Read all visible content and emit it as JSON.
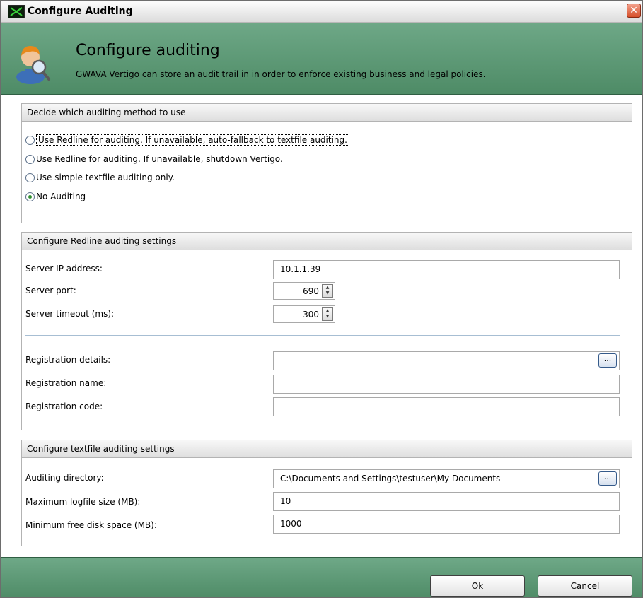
{
  "window": {
    "title": "Configure Auditing",
    "close_glyph": "✕"
  },
  "banner": {
    "title": "Configure auditing",
    "subtitle": "GWAVA Vertigo can store an audit trail in in order to enforce existing business and legal policies.",
    "icon": "user-magnifier-icon"
  },
  "method_group": {
    "header": "Decide which auditing method to use",
    "options": [
      {
        "label": "Use Redline for auditing. If unavailable, auto-fallback to textfile auditing.",
        "checked": false
      },
      {
        "label": "Use Redline for auditing. If unavailable, shutdown Vertigo.",
        "checked": false
      },
      {
        "label": "Use simple textfile auditing only.",
        "checked": false
      },
      {
        "label": "No Auditing",
        "checked": true
      }
    ]
  },
  "redline_group": {
    "header": "Configure Redline auditing settings",
    "server_ip_label": "Server IP address:",
    "server_ip_value": "10.1.1.39",
    "server_port_label": "Server port:",
    "server_port_value": "690",
    "server_timeout_label": "Server timeout (ms):",
    "server_timeout_value": "300",
    "reg_details_label": "Registration details:",
    "reg_details_value": "",
    "reg_name_label": "Registration name:",
    "reg_name_value": "",
    "reg_code_label": "Registration code:",
    "reg_code_value": "",
    "browse_label": "..."
  },
  "textfile_group": {
    "header": "Configure textfile auditing settings",
    "dir_label": "Auditing directory:",
    "dir_value": "C:\\Documents and Settings\\testuser\\My Documents",
    "max_log_label": "Maximum logfile size (MB):",
    "max_log_value": "10",
    "min_free_label": "Minimum free disk space (MB):",
    "min_free_value": "1000",
    "browse_label": "..."
  },
  "footer": {
    "ok_label": "Ok",
    "cancel_label": "Cancel"
  },
  "colors": {
    "banner_green": "#5c9a75",
    "title_bar": "#dcdcdc",
    "accent_radio": "#2f8f2f"
  }
}
